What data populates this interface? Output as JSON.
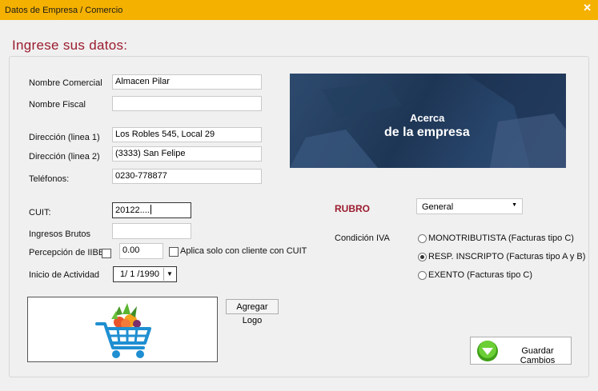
{
  "window": {
    "title": "Datos de Empresa / Comercio",
    "close_glyph": "✕"
  },
  "heading": "Ingrese sus datos:",
  "form": {
    "nombre_comercial": {
      "label": "Nombre Comercial",
      "value": "Almacen Pilar"
    },
    "nombre_fiscal": {
      "label": "Nombre Fiscal",
      "value": ""
    },
    "direccion1": {
      "label": "Dirección (linea 1)",
      "value": "Los Robles 545, Local 29"
    },
    "direccion2": {
      "label": "Dirección (linea 2)",
      "value": "(3333) San Felipe"
    },
    "telefonos": {
      "label": "Teléfonos:",
      "value": "0230-778877"
    },
    "cuit": {
      "label": "CUIT:",
      "value": "20122...."
    },
    "ingresos_brutos": {
      "label": "Ingresos Brutos",
      "value": ""
    },
    "percepcion": {
      "label": "Percepción de IIBB",
      "value": "0.00",
      "checked": false
    },
    "aplica_solo": {
      "label": "Aplica solo con cliente con CUIT",
      "checked": false
    },
    "inicio_actividad": {
      "label": "Inicio de Actividad",
      "value": "1/ 1 /1990",
      "dropdown_glyph": "▼"
    }
  },
  "banner": {
    "line1": "Acerca",
    "line2": "de la empresa"
  },
  "rubro": {
    "label": "RUBRO",
    "selected": "General",
    "dropdown_glyph": "▼"
  },
  "condicion_iva": {
    "label": "Condición IVA",
    "options": [
      {
        "label": "MONOTRIBUTISTA (Facturas tipo C)",
        "selected": false
      },
      {
        "label": "RESP. INSCRIPTO (Facturas tipo A y B)",
        "selected": true
      },
      {
        "label": "EXENTO (Facturas tipo C)",
        "selected": false
      }
    ]
  },
  "buttons": {
    "agregar_logo": "Agregar Logo",
    "guardar": "Guardar Cambios"
  },
  "colors": {
    "titlebar": "#f5b100",
    "accent": "#9b1c2e",
    "save_icon": "#4caf1e"
  },
  "icons": {
    "logo": "shopping-cart-icon",
    "save": "green-down-arrow-icon"
  }
}
